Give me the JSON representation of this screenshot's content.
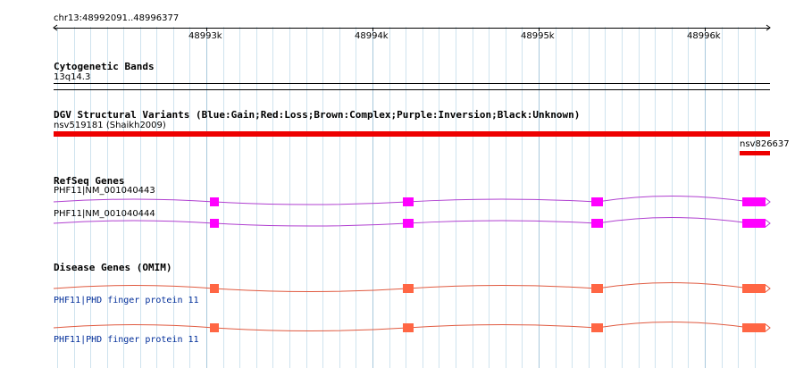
{
  "ruler": {
    "location": "chr13:48992091..48996377",
    "ticks": [
      "48993k",
      "48994k",
      "48995k",
      "48996k"
    ]
  },
  "tracks": {
    "cytoband": {
      "title": "Cytogenetic Bands",
      "band": "13q14.3"
    },
    "dgv": {
      "title": "DGV Structural Variants (Blue:Gain;Red:Loss;Brown:Complex;Purple:Inversion;Black:Unknown)",
      "feature1": "nsv519181 (Shaikh2009)",
      "feature2": "nsv826637",
      "color": "#ee0000"
    },
    "refseq": {
      "title": "RefSeq Genes",
      "gene1": "PHF11|NM_001040443",
      "gene2": "PHF11|NM_001040444",
      "color": "#ff00ff",
      "line_color": "#b040d0"
    },
    "omim": {
      "title": "Disease Genes (OMIM)",
      "gene1": "PHF11|PHD finger protein 11",
      "gene2": "PHF11|PHD finger protein 11",
      "color": "#ff6644",
      "line_color": "#e05a40"
    }
  }
}
